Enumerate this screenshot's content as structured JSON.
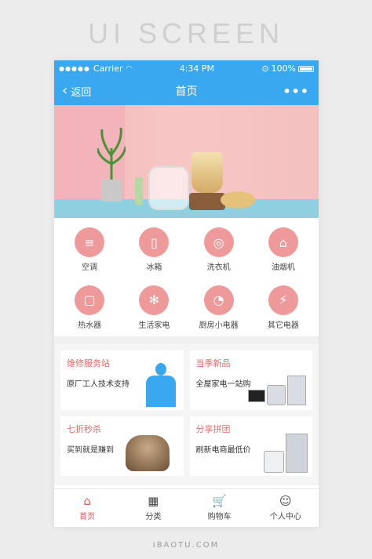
{
  "heading": "UI SCREEN",
  "status": {
    "carrier": "Carrier",
    "time": "4:34 PM",
    "battery": "100%"
  },
  "nav": {
    "back_label": "返回",
    "title": "首页",
    "more_label": "•••"
  },
  "categories": [
    {
      "label": "空调",
      "icon": "air-conditioner-icon",
      "glyph": "≡"
    },
    {
      "label": "冰箱",
      "icon": "fridge-icon",
      "glyph": "▯"
    },
    {
      "label": "洗衣机",
      "icon": "washing-machine-icon",
      "glyph": "◎"
    },
    {
      "label": "油烟机",
      "icon": "range-hood-icon",
      "glyph": "⌂"
    },
    {
      "label": "热水器",
      "icon": "water-heater-icon",
      "glyph": "▢"
    },
    {
      "label": "生活家电",
      "icon": "fan-icon",
      "glyph": "✻"
    },
    {
      "label": "厨房小电器",
      "icon": "kettle-icon",
      "glyph": "◔"
    },
    {
      "label": "其它电器",
      "icon": "plug-icon",
      "glyph": "⚡"
    }
  ],
  "promos": [
    {
      "title": "维修服务站",
      "subtitle": "原厂工人技术支持"
    },
    {
      "title": "当季新品",
      "subtitle": "全屋家电一站购"
    },
    {
      "title": "七折秒杀",
      "subtitle": "买到就是赚到"
    },
    {
      "title": "分享拼团",
      "subtitle": "刷新电商最低价"
    }
  ],
  "tabs": [
    {
      "label": "首页",
      "icon": "home-icon",
      "glyph": "⌂"
    },
    {
      "label": "分类",
      "icon": "grid-icon",
      "glyph": "▦"
    },
    {
      "label": "购物车",
      "icon": "cart-icon",
      "glyph": "🛒"
    },
    {
      "label": "个人中心",
      "icon": "user-icon",
      "glyph": "☺"
    }
  ],
  "footer": "IBAOTU.COM",
  "colors": {
    "accent": "#3aa8f0",
    "category": "#ef9a9a",
    "promo_title": "#e26a6a",
    "active_tab": "#e25555"
  }
}
